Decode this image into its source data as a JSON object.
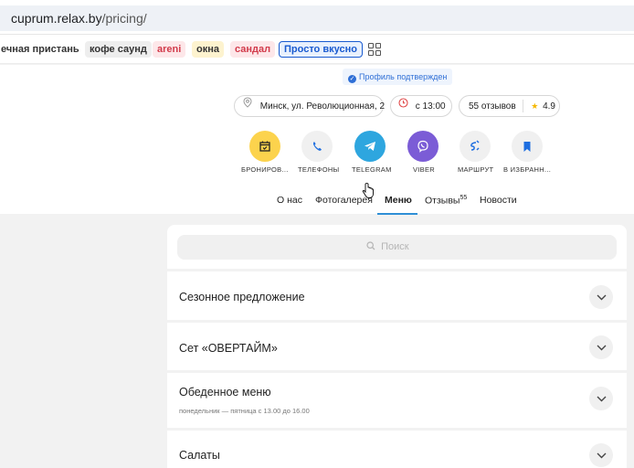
{
  "browser": {
    "url_host": "cuprum.relax.by",
    "url_path": "/pricing/"
  },
  "tags": [
    {
      "label": "ечная пристань",
      "bg": "#ffffff",
      "color": "#333333"
    },
    {
      "label": "кофе саунд",
      "bg": "#eeeeee",
      "color": "#333333"
    },
    {
      "label": "areni",
      "bg": "#fde7e9",
      "color": "#d23b4b"
    },
    {
      "label": "окна",
      "bg": "#fdf3cf",
      "color": "#333333"
    },
    {
      "label": "сандал",
      "bg": "#fde7e9",
      "color": "#d23b4b"
    },
    {
      "label": "Просто вкусно",
      "bg": "#e8f0fd",
      "color": "#1a5bd0"
    }
  ],
  "header": {
    "verified": "Профиль подтвержден",
    "address": "Минск, ул. Революционная, 2",
    "hours": "с 13:00",
    "reviews": "55 отзывов",
    "rating": "4.9"
  },
  "actions": [
    {
      "label": "БРОНИРОВ...",
      "icon": "calendar-icon",
      "bg": "#fcd34d"
    },
    {
      "label": "ТЕЛЕФОНЫ",
      "icon": "phone-icon",
      "bg": "#f0f0f0"
    },
    {
      "label": "TELEGRAM",
      "icon": "telegram-icon",
      "bg": "#2ea6df"
    },
    {
      "label": "VIBER",
      "icon": "viber-icon",
      "bg": "#7b5cd6"
    },
    {
      "label": "МАРШРУТ",
      "icon": "route-icon",
      "bg": "#f0f0f0"
    },
    {
      "label": "В ИЗБРАНН...",
      "icon": "bookmark-icon",
      "bg": "#f0f0f0"
    }
  ],
  "tabs": [
    {
      "label": "О нас"
    },
    {
      "label": "Фотогалерея"
    },
    {
      "label": "Меню",
      "active": true
    },
    {
      "label": "Отзывы",
      "count": "55"
    },
    {
      "label": "Новости"
    }
  ],
  "menu": {
    "search_placeholder": "Поиск",
    "sections": [
      {
        "title": "Сезонное предложение",
        "subtitle": ""
      },
      {
        "title": "Сет «ОВЕРТАЙМ»",
        "subtitle": ""
      },
      {
        "title": "Обеденное меню",
        "subtitle": "понедельник — пятница с 13.00 до 16.00"
      },
      {
        "title": "Салаты",
        "subtitle": ""
      }
    ]
  },
  "colors": {
    "accent": "#2f8fd6",
    "verified": "#2f6fd6",
    "rating_star": "#f5b800",
    "clock": "#e04a4a"
  }
}
